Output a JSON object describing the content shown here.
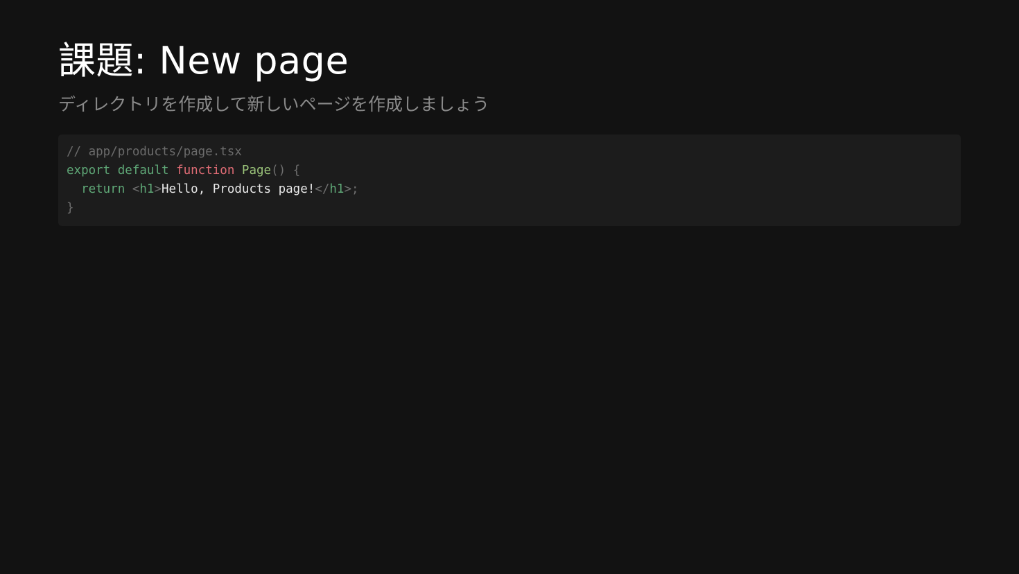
{
  "slide": {
    "title": "課題: New page",
    "subtitle": "ディレクトリを作成して新しいページを作成しましょう"
  },
  "code": {
    "lines": [
      [
        {
          "t": "// app/products/page.tsx",
          "k": "comment"
        }
      ],
      [
        {
          "t": "export",
          "k": "keyword"
        },
        {
          "t": " ",
          "k": "text"
        },
        {
          "t": "default",
          "k": "keyword"
        },
        {
          "t": " ",
          "k": "text"
        },
        {
          "t": "function",
          "k": "fn-kw"
        },
        {
          "t": " ",
          "k": "text"
        },
        {
          "t": "Page",
          "k": "fn-name"
        },
        {
          "t": "() {",
          "k": "punct"
        }
      ],
      [
        {
          "t": "  ",
          "k": "text"
        },
        {
          "t": "return",
          "k": "keyword"
        },
        {
          "t": " ",
          "k": "text"
        },
        {
          "t": "<",
          "k": "punct"
        },
        {
          "t": "h1",
          "k": "tag"
        },
        {
          "t": ">",
          "k": "punct"
        },
        {
          "t": "Hello, Products page!",
          "k": "text"
        },
        {
          "t": "</",
          "k": "punct"
        },
        {
          "t": "h1",
          "k": "tag"
        },
        {
          "t": ">;",
          "k": "punct"
        }
      ],
      [
        {
          "t": "}",
          "k": "punct"
        }
      ]
    ]
  },
  "colors": {
    "background": "#121212",
    "code_background": "#1c1c1c",
    "title": "#ffffff",
    "subtitle": "#8a8a8a",
    "comment": "#6b6b6b",
    "keyword": "#5fa877",
    "function_keyword": "#e06c75",
    "function_name": "#9bc47a"
  }
}
